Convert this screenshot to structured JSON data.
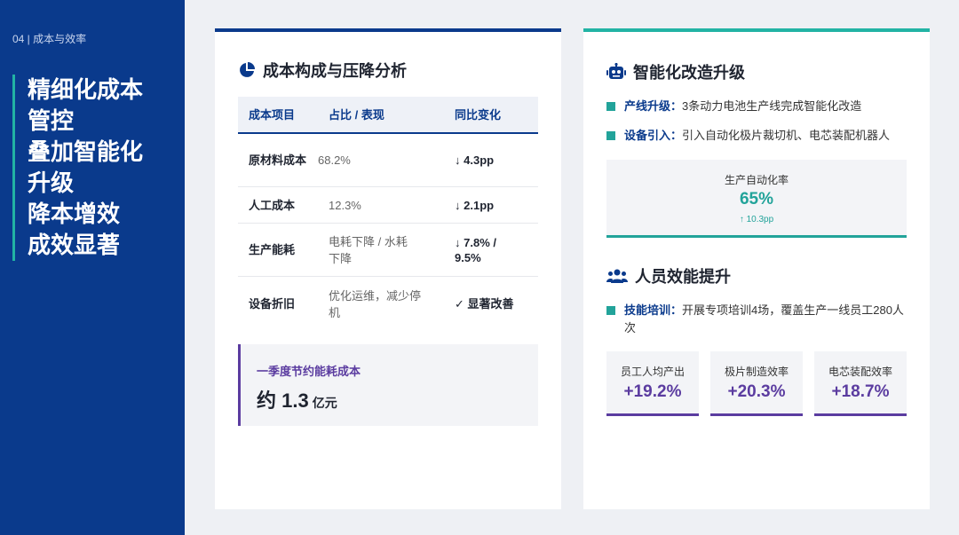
{
  "sidebar": {
    "section_label": "04 | 成本与效率",
    "headline_lines": [
      "精细化成本",
      "管控",
      "叠加智能化",
      "升级",
      "降本增效",
      "成效显著"
    ]
  },
  "cost_card": {
    "title": "成本构成与压降分析",
    "icon": "pie-chart-icon",
    "table": {
      "headers": [
        "成本项目",
        "占比 / 表现",
        "同比变化"
      ],
      "rows": [
        {
          "item": "原材料成本",
          "share": "68.2%",
          "change": "4.3pp",
          "change_icon": "arrow-down-icon"
        },
        {
          "item": "人工成本",
          "share": "12.3%",
          "change": "2.1pp",
          "change_icon": "arrow-down-icon"
        },
        {
          "item": "生产能耗",
          "share": "电耗下降 / 水耗下降",
          "change": "7.8% / 9.5%",
          "change_icon": "arrow-down-icon"
        },
        {
          "item": "设备折旧",
          "share": "优化运维，减少停机",
          "change": "显著改善",
          "change_icon": "check-icon"
        }
      ]
    },
    "callout": {
      "label": "一季度节约能耗成本",
      "value": "约 1.3",
      "unit": "亿元"
    }
  },
  "smart_card": {
    "title": "智能化改造升级",
    "icon": "robot-icon",
    "bullets": [
      {
        "key": "产线升级：",
        "text": "3条动力电池生产线完成智能化改造"
      },
      {
        "key": "设备引入：",
        "text": "引入自动化极片裁切机、电芯装配机器人"
      }
    ],
    "automation": {
      "label": "生产自动化率",
      "value": "65%",
      "delta": "10.3pp",
      "delta_icon": "arrow-up-icon"
    }
  },
  "staff": {
    "title": "人员效能提升",
    "icon": "users-icon",
    "bullet": {
      "key": "技能培训：",
      "text": "开展专项培训4场，覆盖生产一线员工280人次"
    },
    "metrics": [
      {
        "label": "员工人均产出",
        "value": "+19.2%"
      },
      {
        "label": "极片制造效率",
        "value": "+20.3%"
      },
      {
        "label": "电芯装配效率",
        "value": "+18.7%"
      }
    ]
  },
  "colors": {
    "navy": "#0a3a8c",
    "teal": "#22a39a",
    "purple": "#5b3ca0"
  }
}
